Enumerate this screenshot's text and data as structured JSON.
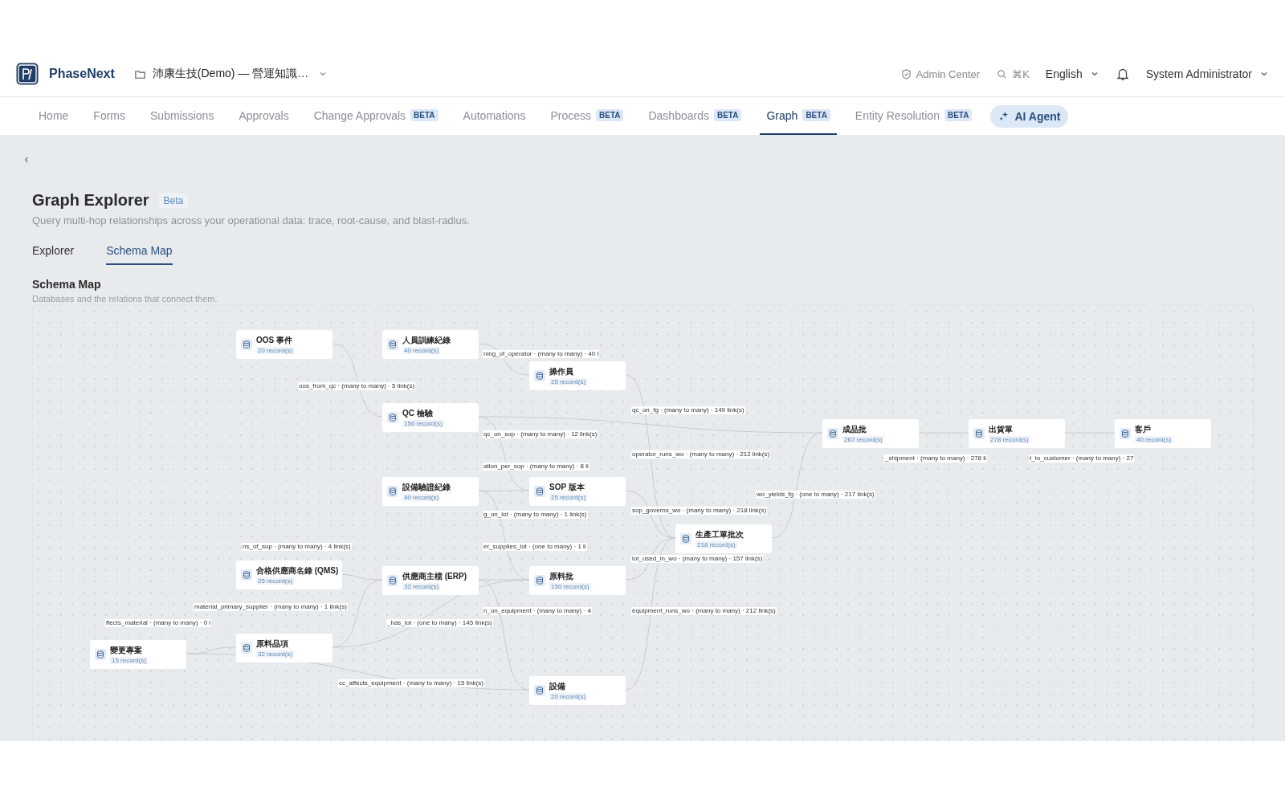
{
  "brand": {
    "name": "PhaseNext"
  },
  "workspace": {
    "name": "沛康生技(Demo) — 營運知識…"
  },
  "header_actions": {
    "admin": "Admin Center",
    "search_shortcut": "⌘K",
    "language": "English",
    "user": "System Administrator"
  },
  "nav": [
    {
      "label": "Home",
      "selected": false
    },
    {
      "label": "Forms",
      "selected": false
    },
    {
      "label": "Submissions",
      "selected": false
    },
    {
      "label": "Approvals",
      "selected": false
    },
    {
      "label": "Change Approvals",
      "badge": "BETA",
      "selected": false
    },
    {
      "label": "Automations",
      "selected": false
    },
    {
      "label": "Process",
      "badge": "BETA",
      "selected": false
    },
    {
      "label": "Dashboards",
      "badge": "BETA",
      "selected": false
    },
    {
      "label": "Graph",
      "badge": "BETA",
      "selected": true
    },
    {
      "label": "Entity Resolution",
      "badge": "BETA",
      "selected": false
    }
  ],
  "ai_button": {
    "label": "AI Agent"
  },
  "page": {
    "title": "Graph Explorer",
    "badge": "Beta",
    "subtitle": "Query multi-hop relationships across your operational data: trace, root-cause, and blast-radius."
  },
  "tabs": [
    {
      "label": "Explorer",
      "selected": false
    },
    {
      "label": "Schema Map",
      "selected": true
    }
  ],
  "section": {
    "title": "Schema Map",
    "subtitle": "Databases and the relations that connect them."
  },
  "nodes": [
    {
      "name": "OOS 事件",
      "records": "20 record(s)"
    },
    {
      "name": "人員訓練紀錄",
      "records": "40 record(s)"
    },
    {
      "name": "操作員",
      "records": "25 record(s)"
    },
    {
      "name": "QC 檢驗",
      "records": "150 record(s)"
    },
    {
      "name": "成品批",
      "records": "267 record(s)"
    },
    {
      "name": "出貨單",
      "records": "278 record(s)"
    },
    {
      "name": "客戶",
      "records": "40 record(s)"
    },
    {
      "name": "設備驗證紀錄",
      "records": "40 record(s)"
    },
    {
      "name": "SOP 版本",
      "records": "25 record(s)"
    },
    {
      "name": "生產工單批次",
      "records": "218 record(s)"
    },
    {
      "name": "合格供應商名錄 (QMS)",
      "records": "25 record(s)"
    },
    {
      "name": "供應商主檔 (ERP)",
      "records": "32 record(s)"
    },
    {
      "name": "原料批",
      "records": "150 record(s)"
    },
    {
      "name": "變更專案",
      "records": "15 record(s)"
    },
    {
      "name": "原料品項",
      "records": "32 record(s)"
    },
    {
      "name": "設備",
      "records": "20 record(s)"
    }
  ],
  "edges": [
    {
      "label": "ning_of_operator · (many to many) · 40 l"
    },
    {
      "label": "oos_from_qc · (many to many) · 5 link(s)"
    },
    {
      "label": "qc_on_sop · (many to many) · 12 link(s)"
    },
    {
      "label": "qc_on_fg · (many to many) · 149 link(s)"
    },
    {
      "label": "operator_runs_wo · (many to many) · 212 link(s)"
    },
    {
      "label": "_shipment · (many to many) · 278 li"
    },
    {
      "label": "t_to_customer · (many to many) · 27"
    },
    {
      "label": "wo_yields_fg · (one to many) · 217 link(s)"
    },
    {
      "label": "ation_per_sop · (many to many) · 8 li"
    },
    {
      "label": "g_on_lot · (many to many) · 1 link(s)"
    },
    {
      "label": "sop_governs_wo · (many to many) · 218 link(s)"
    },
    {
      "label": "lot_used_in_wo · (many to many) · 157 link(s)"
    },
    {
      "label": "equipment_runs_wo · (many to many) · 212 link(s)"
    },
    {
      "label": "ns_of_sup · (many to many) · 4 link(s)"
    },
    {
      "label": "er_supplies_lot · (one to many) · 1 li"
    },
    {
      "label": "n_on_equipment · (many to many) · 4"
    },
    {
      "label": "material_primary_supplier · (many to many) · 1 link(s)"
    },
    {
      "label": "ffects_material · (many to many) · 0 l"
    },
    {
      "label": "_has_lot · (one to many) · 145 link(s)"
    },
    {
      "label": "cc_affects_equipment · (many to many) · 15 link(s)"
    }
  ]
}
